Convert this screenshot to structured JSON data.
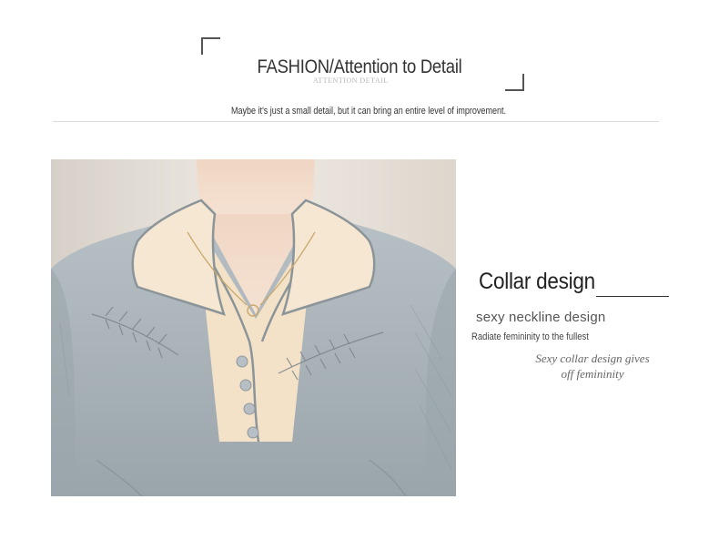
{
  "header": {
    "title": "FASHION/Attention to Detail",
    "ghost_text": "ATTENTION DETAIL",
    "subtitle": "Maybe it's just a small detail, but it can bring an entire level of improvement."
  },
  "feature": {
    "title": "Collar design",
    "heading": "sexy neckline design",
    "tagline": "Radiate femininity to the fullest",
    "script_line1": "Sexy collar design gives",
    "script_line2": "off femininity"
  },
  "colors": {
    "sweater": "#a9b3b8",
    "collar": "#f4e2c8",
    "background": "#e7e2db",
    "skin": "#f1dccc"
  },
  "icons": [
    "corner-bracket-top-left",
    "corner-bracket-bottom-right"
  ]
}
